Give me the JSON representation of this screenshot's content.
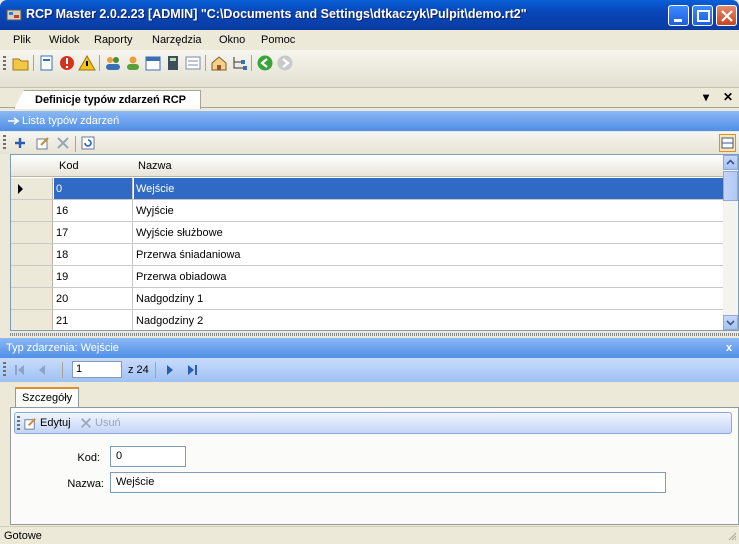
{
  "window": {
    "title": "RCP Master 2.0.2.23  [ADMIN] \"C:\\Documents and Settings\\dtkaczyk\\Pulpit\\demo.rt2\""
  },
  "menu": [
    "Plik",
    "Widok",
    "Raporty",
    "Narzędzia",
    "Okno",
    "Pomoc"
  ],
  "toolbar_icons": [
    "open-folder-icon",
    "report-icon",
    "error-icon",
    "warning-icon",
    "users-icon",
    "user-icon",
    "calendar-icon",
    "calculator-icon",
    "list-icon",
    "home-icon",
    "tree-icon",
    "back-icon",
    "forward-icon"
  ],
  "tab": {
    "title": "Definicje typów zdarzeń RCP",
    "pin": "▾",
    "close": "✕"
  },
  "list_section": {
    "title": "Lista typów zdarzeń"
  },
  "grid": {
    "columns": {
      "kod": "Kod",
      "nazwa": "Nazwa"
    },
    "rows": [
      {
        "kod": "0",
        "nazwa": "Wejście",
        "selected": true
      },
      {
        "kod": "16",
        "nazwa": "Wyjście"
      },
      {
        "kod": "17",
        "nazwa": "Wyjście służbowe"
      },
      {
        "kod": "18",
        "nazwa": "Przerwa śniadaniowa"
      },
      {
        "kod": "19",
        "nazwa": "Przerwa obiadowa"
      },
      {
        "kod": "20",
        "nazwa": "Nadgodziny 1"
      },
      {
        "kod": "21",
        "nazwa": "Nadgodziny 2"
      }
    ]
  },
  "detail_section": {
    "title": "Typ zdarzenia: Wejście",
    "close": "x"
  },
  "navigator": {
    "position": "1",
    "total": "z 24"
  },
  "details": {
    "tab": "Szczegóły",
    "edit_label": "Edytuj",
    "delete_label": "Usuń",
    "kod_label": "Kod:",
    "kod_value": "0",
    "nazwa_label": "Nazwa:",
    "nazwa_value": "Wejście"
  },
  "status": {
    "text": "Gotowe"
  },
  "colors": {
    "titlebar": "#0846b7",
    "selection": "#316ac5",
    "section": "#4f8fe6"
  }
}
